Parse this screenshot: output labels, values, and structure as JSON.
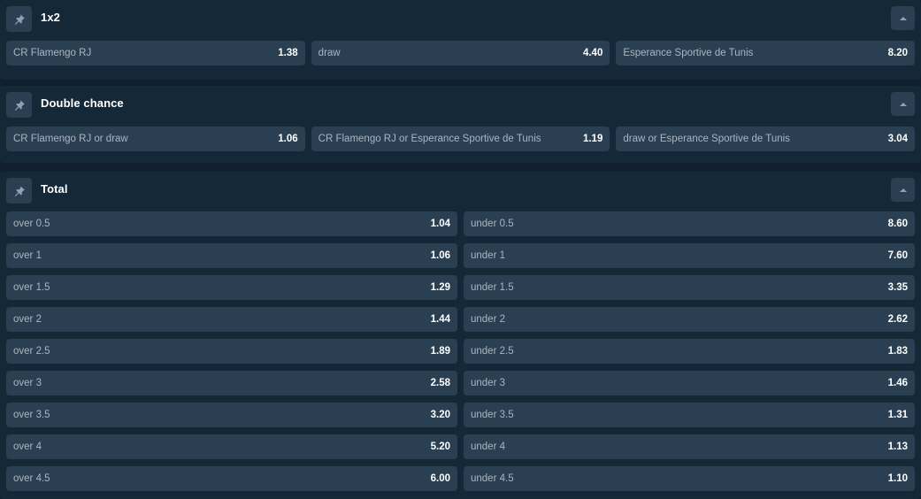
{
  "markets": {
    "onextwo": {
      "title": "1x2",
      "odds": [
        {
          "label": "CR Flamengo RJ",
          "value": "1.38"
        },
        {
          "label": "draw",
          "value": "4.40"
        },
        {
          "label": "Esperance Sportive de Tunis",
          "value": "8.20"
        }
      ]
    },
    "double_chance": {
      "title": "Double chance",
      "odds": [
        {
          "label": "CR Flamengo RJ or draw",
          "value": "1.06"
        },
        {
          "label": "CR Flamengo RJ or Esperance Sportive de Tunis",
          "value": "1.19"
        },
        {
          "label": "draw or Esperance Sportive de Tunis",
          "value": "3.04"
        }
      ]
    },
    "total": {
      "title": "Total",
      "rows": [
        {
          "over_label": "over 0.5",
          "over_value": "1.04",
          "under_label": "under 0.5",
          "under_value": "8.60"
        },
        {
          "over_label": "over 1",
          "over_value": "1.06",
          "under_label": "under 1",
          "under_value": "7.60"
        },
        {
          "over_label": "over 1.5",
          "over_value": "1.29",
          "under_label": "under 1.5",
          "under_value": "3.35"
        },
        {
          "over_label": "over 2",
          "over_value": "1.44",
          "under_label": "under 2",
          "under_value": "2.62"
        },
        {
          "over_label": "over 2.5",
          "over_value": "1.89",
          "under_label": "under 2.5",
          "under_value": "1.83"
        },
        {
          "over_label": "over 3",
          "over_value": "2.58",
          "under_label": "under 3",
          "under_value": "1.46"
        },
        {
          "over_label": "over 3.5",
          "over_value": "3.20",
          "under_label": "under 3.5",
          "under_value": "1.31"
        },
        {
          "over_label": "over 4",
          "over_value": "5.20",
          "under_label": "under 4",
          "under_value": "1.13"
        },
        {
          "over_label": "over 4.5",
          "over_value": "6.00",
          "under_label": "under 4.5",
          "under_value": "1.10"
        }
      ]
    }
  },
  "icons": {
    "pin": "pin-icon",
    "collapse": "chevron-up-icon"
  },
  "colors": {
    "background": "#102030",
    "panel": "#152838",
    "button": "#2a3f52",
    "value": "#ffffff",
    "label": "#aab6c2"
  }
}
